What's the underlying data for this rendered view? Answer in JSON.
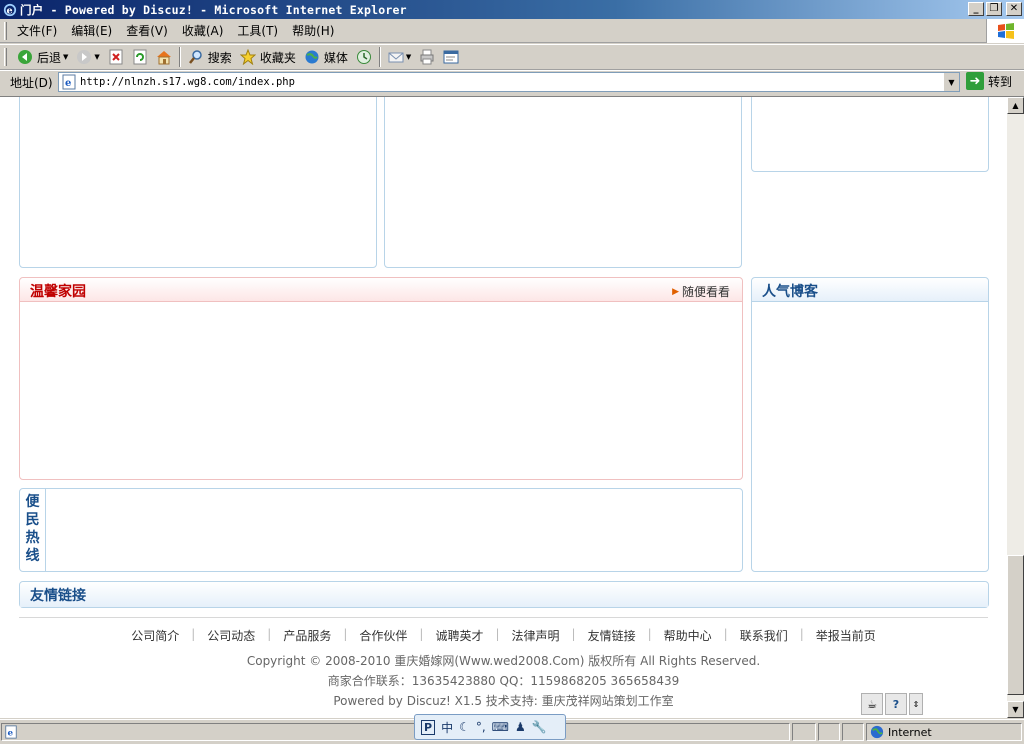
{
  "window": {
    "title": "门户 - Powered by Discuz! - Microsoft Internet Explorer",
    "btn_minimize": "_",
    "btn_maximize": "❐",
    "btn_close": "✕"
  },
  "menu": {
    "items": [
      "文件(F)",
      "编辑(E)",
      "查看(V)",
      "收藏(A)",
      "工具(T)",
      "帮助(H)"
    ]
  },
  "toolbar": {
    "back": "后退",
    "search": "搜索",
    "favorites": "收藏夹",
    "media": "媒体"
  },
  "address": {
    "label": "地址(D)",
    "url": "http://nlnzh.s17.wg8.com/index.php",
    "go": "转到"
  },
  "content": {
    "warm_home_title": "温馨家园",
    "warm_home_more": "随便看看",
    "popular_blogs_title": "人气博客",
    "hotline_title": [
      "便",
      "民",
      "热",
      "线"
    ],
    "friend_links_title": "友情链接"
  },
  "footer": {
    "links": [
      "公司简介",
      "公司动态",
      "产品服务",
      "合作伙伴",
      "诚聘英才",
      "法律声明",
      "友情链接",
      "帮助中心",
      "联系我们",
      "举报当前页"
    ],
    "copyright": "Copyright © 2008-2010 重庆婚嫁网(Www.wed2008.Com) 版权所有 All Rights Reserved.",
    "contact": "商家合作联系：13635423880 QQ：1159868205 365658439",
    "powered": "Powered by Discuz! X1.5  技术支持: 重庆茂祥网站策划工作室"
  },
  "status": {
    "zone": "Internet"
  },
  "ime": {
    "label": "中"
  },
  "colors": {
    "title_bar": "#0a246a",
    "red_heading": "#c00000",
    "blue_heading": "#1a4f8a",
    "box_border": "#b8d4e8"
  }
}
